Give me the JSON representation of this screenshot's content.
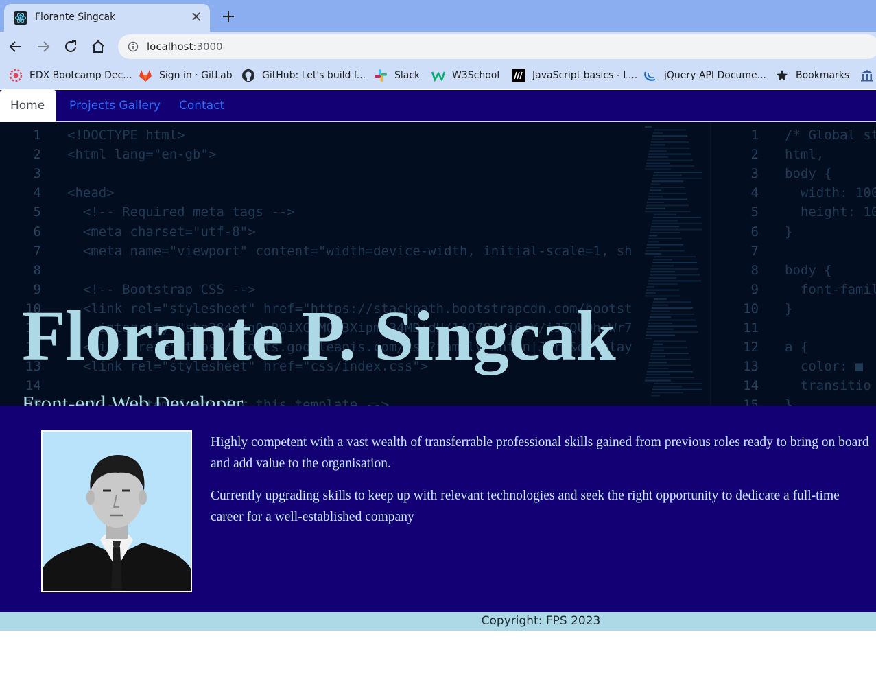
{
  "browser": {
    "tab": {
      "title": "Florante Singcak"
    },
    "address": {
      "host": "localhost",
      "port": ":3000"
    },
    "bookmarks": [
      {
        "label": "EDX Bootcamp Dec...",
        "icon": "edx-icon"
      },
      {
        "label": "Sign in · GitLab",
        "icon": "gitlab-icon"
      },
      {
        "label": "GitHub: Let's build f...",
        "icon": "github-icon"
      },
      {
        "label": "Slack",
        "icon": "slack-icon"
      },
      {
        "label": "W3School",
        "icon": "w3school-icon"
      },
      {
        "label": "JavaScript basics - L...",
        "icon": "mdn-icon"
      },
      {
        "label": "jQuery API Docume...",
        "icon": "jquery-icon"
      },
      {
        "label": "Bookmarks",
        "icon": "star-icon"
      }
    ]
  },
  "nav": {
    "home": "Home",
    "projects": "Projects Gallery",
    "contact": "Contact"
  },
  "hero": {
    "title": "Florante P. Singcak",
    "subtitle": "Front-end Web Developer"
  },
  "code_lines_left": [
    {
      "n": "1",
      "t": "<!DOCTYPE html>"
    },
    {
      "n": "2",
      "t": "<html lang=\"en-gb\">"
    },
    {
      "n": "3",
      "t": ""
    },
    {
      "n": "4",
      "t": "<head>"
    },
    {
      "n": "5",
      "t": "  <!-- Required meta tags -->"
    },
    {
      "n": "6",
      "t": "  <meta charset=\"utf-8\">"
    },
    {
      "n": "7",
      "t": "  <meta name=\"viewport\" content=\"width=device-width, initial-scale=1, sh"
    },
    {
      "n": "8",
      "t": ""
    },
    {
      "n": "9",
      "t": "  <!-- Bootstrap CSS -->"
    },
    {
      "n": "10",
      "t": "  <link rel=\"stylesheet\" href=\"https://stackpath.bootstrapcdn.com/bootst"
    },
    {
      "n": "11",
      "t": "    integrity=\"sha384-ggOyR0iXCbMQv3Xipma34MD+dH/1fQ784/j6cY/iJTQUOhcWr7"
    },
    {
      "n": "12",
      "t": "  <link href=\"https://fonts.googleapis.com/css?family=Anton|Jura&display"
    },
    {
      "n": "13",
      "t": "  <link rel=\"stylesheet\" href=\"css/index.css\">"
    },
    {
      "n": "14",
      "t": ""
    },
    {
      "n": "15",
      "t": "  <!-- Custom fonts for this template -->"
    }
  ],
  "code_lines_right": [
    {
      "n": "1",
      "t": "/* Global st"
    },
    {
      "n": "2",
      "t": "html,"
    },
    {
      "n": "3",
      "t": "body {"
    },
    {
      "n": "4",
      "t": "  width: 100"
    },
    {
      "n": "5",
      "t": "  height: 10"
    },
    {
      "n": "6",
      "t": "}"
    },
    {
      "n": "7",
      "t": ""
    },
    {
      "n": "8",
      "t": "body {"
    },
    {
      "n": "9",
      "t": "  font-famil"
    },
    {
      "n": "10",
      "t": "}"
    },
    {
      "n": "11",
      "t": ""
    },
    {
      "n": "12",
      "t": "a {"
    },
    {
      "n": "13",
      "t": "  color: ■"
    },
    {
      "n": "14",
      "t": "  transitio"
    },
    {
      "n": "15",
      "t": "}"
    }
  ],
  "about": {
    "p1": "Highly competent with a vast wealth of transferrable professional skills gained from previous roles ready to bring on board and add value to the organisation.",
    "p2": "Currently upgrading skills to keep up with relevant technologies and seek the right opportunity to dedicate a full-time career for a well-established company"
  },
  "footer": {
    "text": "Copyright: FPS 2023"
  },
  "colors": {
    "nav_bg": "#130074",
    "hero_bg": "#020d1f",
    "hero_text": "#add8e6",
    "footer_bg": "#add8e6",
    "link": "#2e6bff"
  }
}
